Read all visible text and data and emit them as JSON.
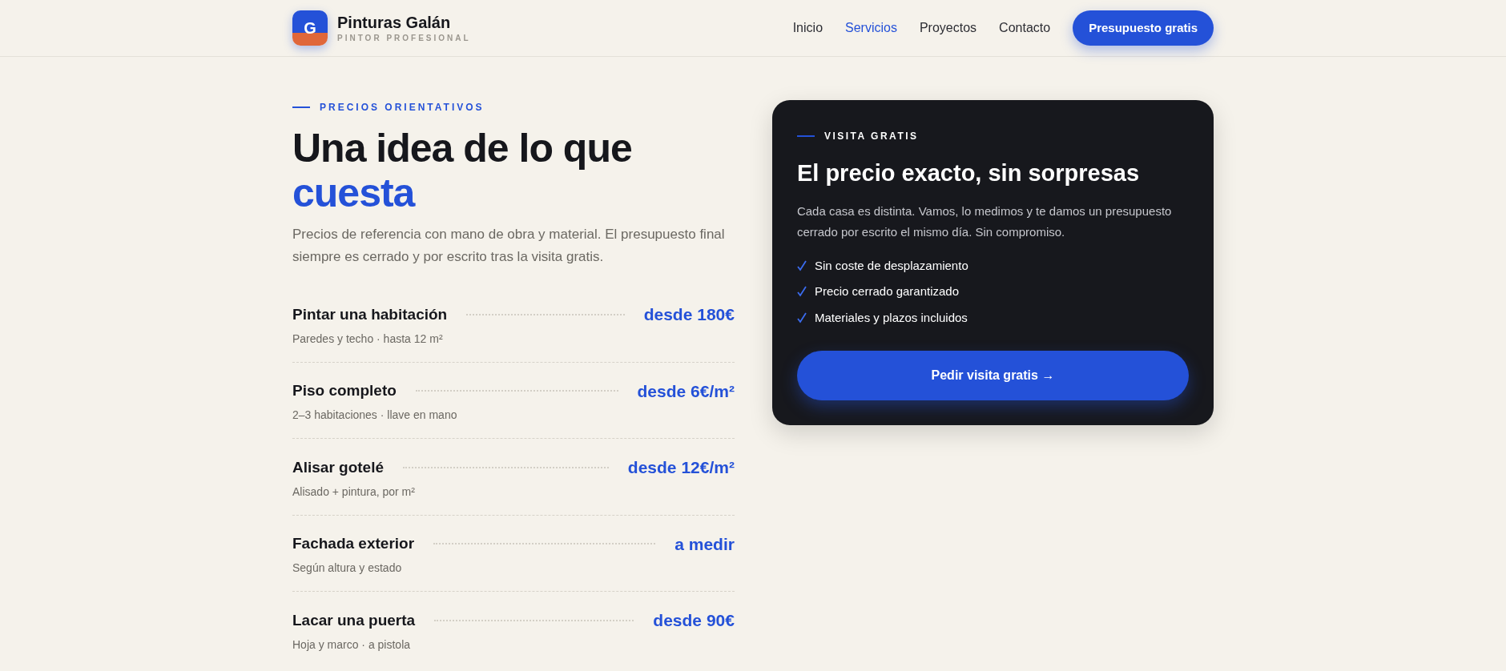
{
  "header": {
    "logo_letter": "G",
    "brand": "Pinturas Galán",
    "tagline": "PINTOR PROFESIONAL",
    "nav": [
      {
        "label": "Inicio",
        "selected": false
      },
      {
        "label": "Servicios",
        "selected": true
      },
      {
        "label": "Proyectos",
        "selected": false
      },
      {
        "label": "Contacto",
        "selected": false
      }
    ],
    "cta": "Presupuesto gratis"
  },
  "pricing": {
    "eyebrow": "PRECIOS ORIENTATIVOS",
    "title": "Una idea de lo que",
    "title_highlight": "cuesta",
    "intro": "Precios de referencia con mano de obra y material. El presupuesto final siempre es cerrado y por escrito tras la visita gratis.",
    "items": [
      {
        "name": "Pintar una habitación",
        "detail": "Paredes y techo · hasta 12 m²",
        "price": "desde 180€"
      },
      {
        "name": "Piso completo",
        "detail": "2–3 habitaciones · llave en mano",
        "price": "desde 6€/m²"
      },
      {
        "name": "Alisar gotelé",
        "detail": "Alisado + pintura, por m²",
        "price": "desde 12€/m²"
      },
      {
        "name": "Fachada exterior",
        "detail": "Según altura y estado",
        "price": "a medir"
      },
      {
        "name": "Lacar una puerta",
        "detail": "Hoja y marco · a pistola",
        "price": "desde 90€"
      }
    ]
  },
  "visit_card": {
    "eyebrow": "VISITA GRATIS",
    "title": "El precio exacto, sin sorpresas",
    "text": "Cada casa es distinta. Vamos, lo medimos y te damos un presupuesto cerrado por escrito el mismo día. Sin compromiso.",
    "benefits": [
      "Sin coste de desplazamiento",
      "Precio cerrado garantizado",
      "Materiales y plazos incluidos"
    ],
    "button": "Pedir visita gratis →"
  }
}
